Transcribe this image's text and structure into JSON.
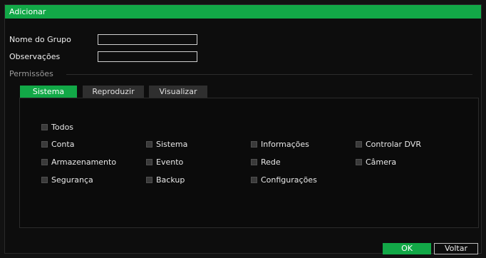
{
  "dialog": {
    "title": "Adicionar"
  },
  "form": {
    "group_name_label": "Nome do Grupo",
    "group_name_value": "",
    "notes_label": "Observações",
    "notes_value": ""
  },
  "permissions": {
    "section_label": "Permissões",
    "tabs": [
      {
        "label": "Sistema",
        "active": true
      },
      {
        "label": "Reproduzir",
        "active": false
      },
      {
        "label": "Visualizar",
        "active": false
      }
    ],
    "all_label": "Todos",
    "items": [
      "Conta",
      "Sistema",
      "Informações",
      "Controlar DVR",
      "Armazenamento",
      "Evento",
      "Rede",
      "Câmera",
      "Segurança",
      "Backup",
      "Configurações"
    ]
  },
  "buttons": {
    "ok": "OK",
    "back": "Voltar"
  },
  "colors": {
    "accent": "#12a847",
    "background": "#0d0d0d"
  }
}
